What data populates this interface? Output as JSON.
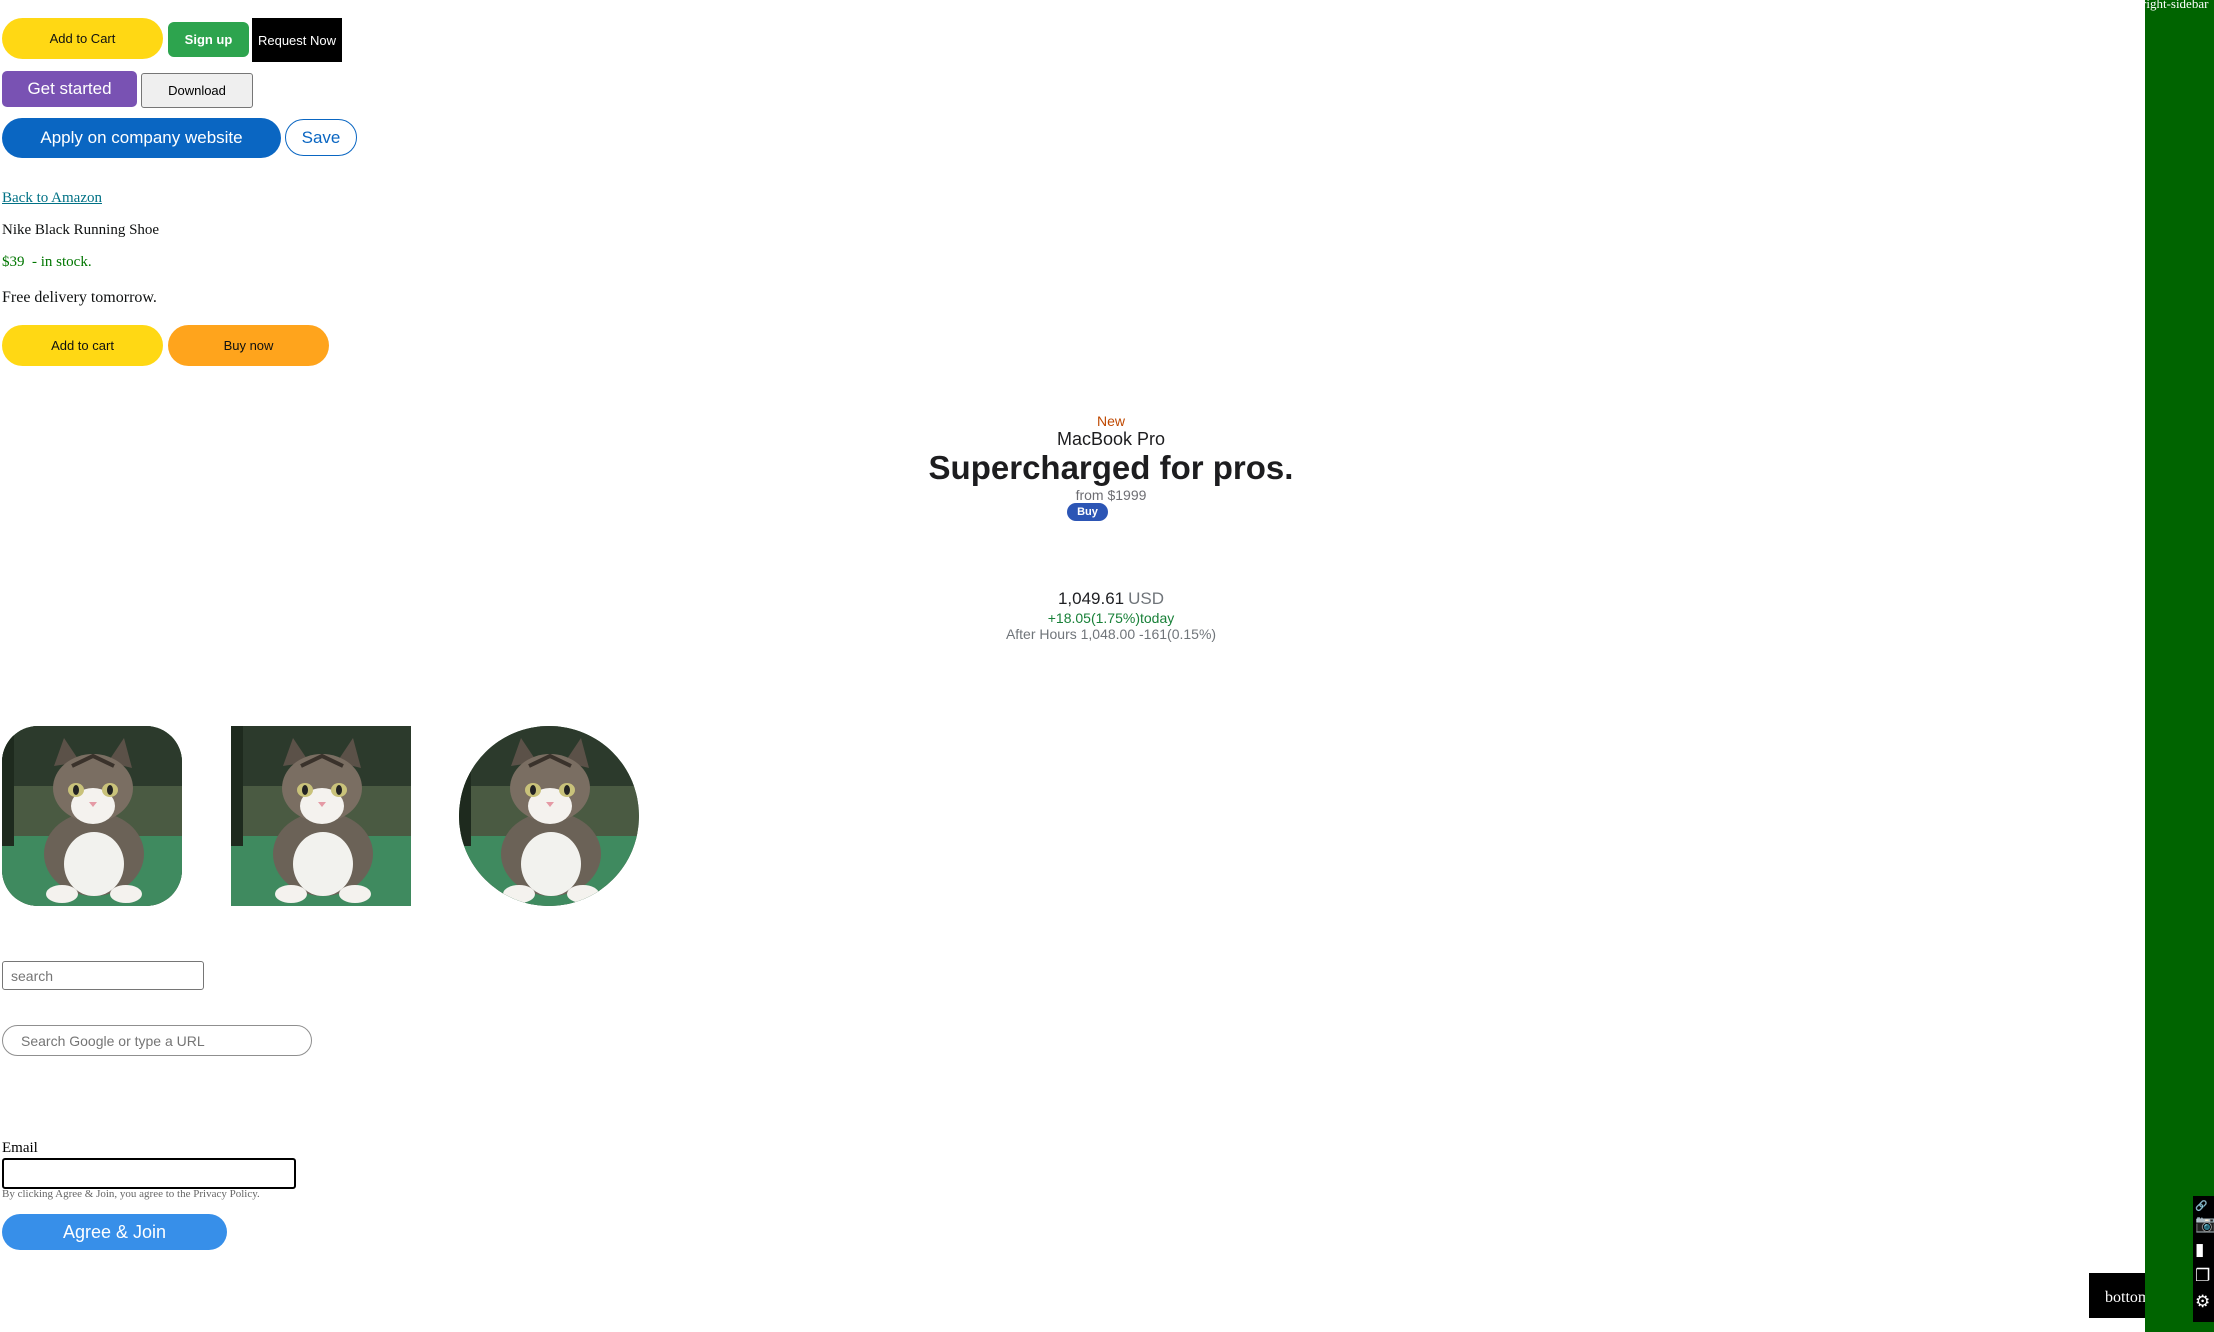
{
  "buttons_row1": {
    "add_to_cart": "Add to Cart",
    "sign_up": "Sign up",
    "request_now": "Request Now"
  },
  "buttons_row2": {
    "get_started": "Get started",
    "download": "Download"
  },
  "buttons_row3": {
    "apply": "Apply on company website",
    "save": "Save"
  },
  "product": {
    "back_link": "Back to Amazon",
    "title": "Nike Black Running Shoe",
    "price": "$39",
    "stock": "- in stock.",
    "delivery": "Free delivery tomorrow.",
    "add_to_cart": "Add to cart",
    "buy_now": "Buy now"
  },
  "macbook": {
    "badge": "New",
    "name": "MacBook Pro",
    "headline": "Supercharged for pros.",
    "price": "from $1999",
    "buy": "Buy"
  },
  "stock": {
    "price": "1,049.61",
    "currency": "USD",
    "change": "+18.05(1.75%)today",
    "after_hours": "After Hours 1,048.00 -161(0.15%)"
  },
  "images": [
    {
      "alt": "cat"
    },
    {
      "alt": "cat"
    },
    {
      "alt": "cat"
    }
  ],
  "search": {
    "placeholder1": "search",
    "placeholder2": "Search Google or type a URL"
  },
  "signup_form": {
    "email_label": "Email",
    "hint": "By clicking Agree & Join, you agree to the Privacy Policy.",
    "agree": "Agree &  Join"
  },
  "sidebar": {
    "label": "right-sidebar",
    "icons": [
      "link-icon",
      "camera-icon",
      "video-icon",
      "window-icon",
      "gear-icon"
    ]
  },
  "bottom": {
    "label": "bottom"
  },
  "colors": {
    "sidebar": "#006400",
    "amazon_yellow": "#ffd814",
    "amazon_orange": "#ffa41c",
    "linkedin_blue": "#0a66c2",
    "apple_blue": "#2c55b5"
  }
}
